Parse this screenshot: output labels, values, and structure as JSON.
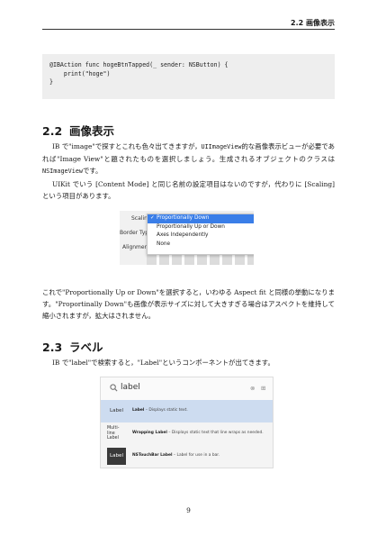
{
  "running_header": "2.2 画像表示",
  "code_block": [
    "@IBAction func hogeBtnTapped(_ sender: NSButton) {",
    "    print(\"hoge\")",
    "}"
  ],
  "section_22": {
    "number": "2.2",
    "title": "画像表示",
    "p1_pre": "IB で\"image\"で探すとこれも色々出てきますが，",
    "p1_code1": "UIImageView",
    "p1_mid": "的な画像表示ビューが必要であれば\"Image View\"と題されたものを選択しましょう。生成されるオブジェクトのクラスは",
    "p1_code2": "NSImageView",
    "p1_post": "です。",
    "p2": "UIKit でいう [Content Mode] と同じ名前の設定項目はないのですが，代わりに [Scaling] という項目があります。"
  },
  "figure_scaling": {
    "row_labels": [
      "Scaling",
      "Border Type",
      "Alignment"
    ],
    "options": [
      "Proportionally Down",
      "Proportionally Up or Down",
      "Axes Independently",
      "None"
    ],
    "selected_check": "✓"
  },
  "para_after_figure": "これで\"Proportionally Up or Down\"を選択すると，いわゆる Aspect fit と同様の挙動になります。\"Proportinally Down\"も画像が表示サイズに対して大きすぎる場合はアスペクトを維持して縮小されますが，拡大はされません。",
  "section_23": {
    "number": "2.3",
    "title": "ラベル",
    "p1": "IB で\"label\"で検索すると，\"Label\"というコンポーネントが出てきます。"
  },
  "figure_library": {
    "search_value": "label",
    "results": [
      {
        "thumb": "Label",
        "name": "Label",
        "desc": " – Displays static text."
      },
      {
        "thumb": "Multi-\nline\nLabel",
        "name": "Wrapping Label",
        "desc": " – Displays static text that line wraps as needed."
      },
      {
        "thumb": "Label",
        "name": "NSTouchBar Label",
        "desc": " – Label for use in a bar."
      }
    ]
  },
  "page_number": "9"
}
